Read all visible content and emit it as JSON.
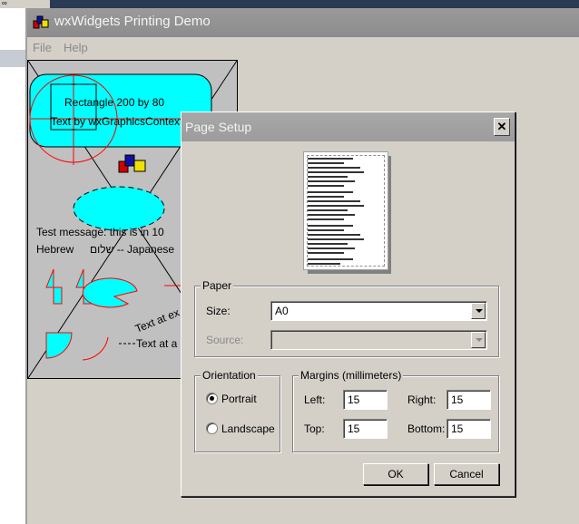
{
  "window": {
    "title": "wxWidgets Printing Demo"
  },
  "menu": {
    "file": "File",
    "help": "Help"
  },
  "canvas": {
    "rect_label": "Rectangle 200 by 80",
    "gc_label": "Text by wxGraphicsContext",
    "test_message": "Test message: this is in 10",
    "hebrew_label": "Hebrew",
    "hebrew_text": "שלום -- Japanese",
    "rotated_text": "Text at ex",
    "angle_text": "Text at a"
  },
  "dialog": {
    "title": "Page Setup",
    "close_glyph": "✕",
    "paper_group": "Paper",
    "size_label": "Size:",
    "size_value": "A0",
    "source_label": "Source:",
    "source_value": "",
    "orientation_group": "Orientation",
    "portrait_label": "Portrait",
    "landscape_label": "Landscape",
    "orientation_selected": "Portrait",
    "margins_group": "Margins (millimeters)",
    "left_label": "Left:",
    "left_value": "15",
    "right_label": "Right:",
    "right_value": "15",
    "top_label": "Top:",
    "top_value": "15",
    "bottom_label": "Bottom:",
    "bottom_value": "15",
    "ok_label": "OK",
    "cancel_label": "Cancel"
  },
  "icons": {
    "app": "wx-app-icon",
    "close": "close-icon",
    "dropdown": "chevron-down-icon",
    "wx_logo": "wx-logo-icon"
  },
  "colors": {
    "shape_fill": "#00ffff",
    "shape_stroke": "#ff0000",
    "canvas_bg": "#c0c0c0",
    "title_bar": "#9a9a9a",
    "dialog_bg": "#d4d0c8"
  }
}
